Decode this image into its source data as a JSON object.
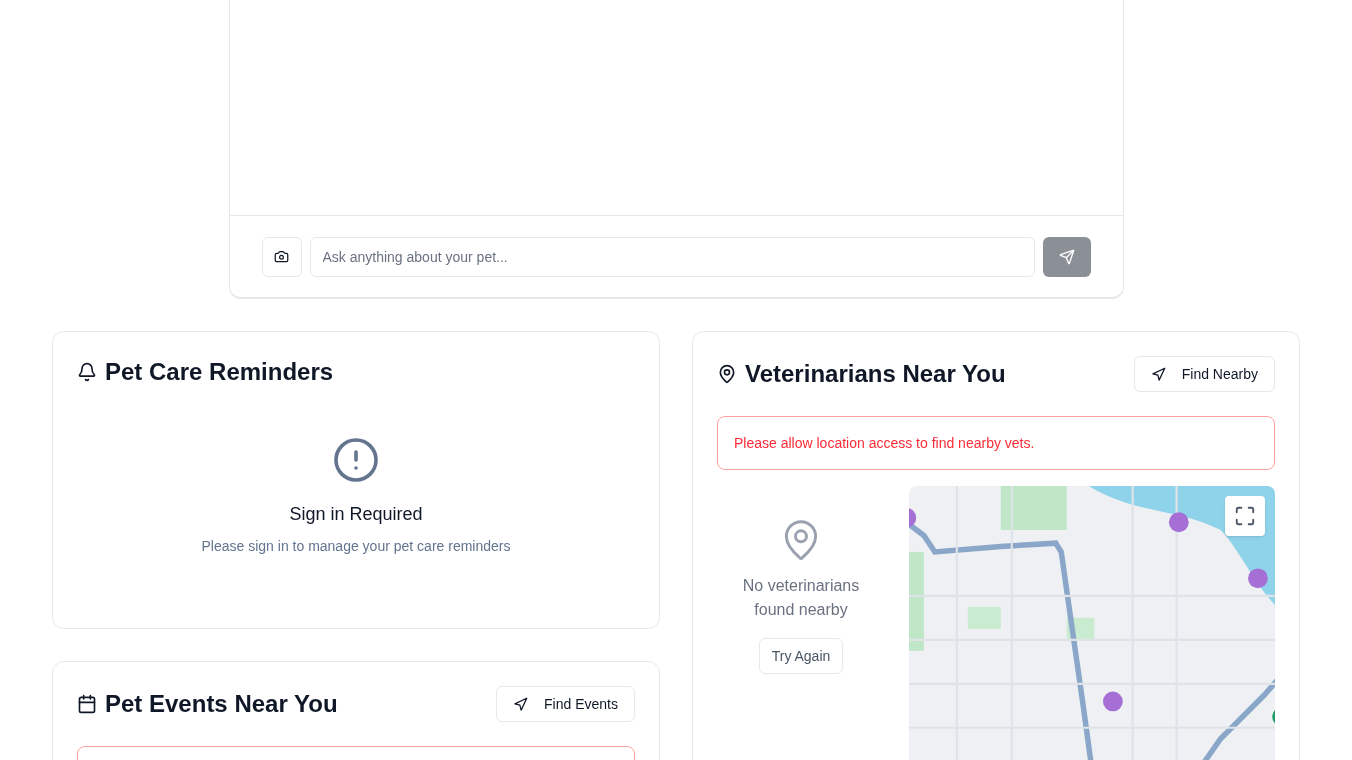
{
  "chat": {
    "input": {
      "placeholder": "Ask anything about your pet..."
    },
    "send_button": {
      "disabled": true
    }
  },
  "reminders": {
    "title": "Pet Care Reminders",
    "empty_state": {
      "title": "Sign in Required",
      "message": "Please sign in to manage your pet care reminders"
    }
  },
  "events": {
    "title": "Pet Events Near You",
    "button": "Find Events"
  },
  "vets": {
    "title": "Veterinarians Near You",
    "button": "Find Nearby",
    "alert": "Please allow location access to find nearby vets.",
    "empty_state": {
      "message": "No veterinarians found nearby",
      "button": "Try Again"
    }
  }
}
